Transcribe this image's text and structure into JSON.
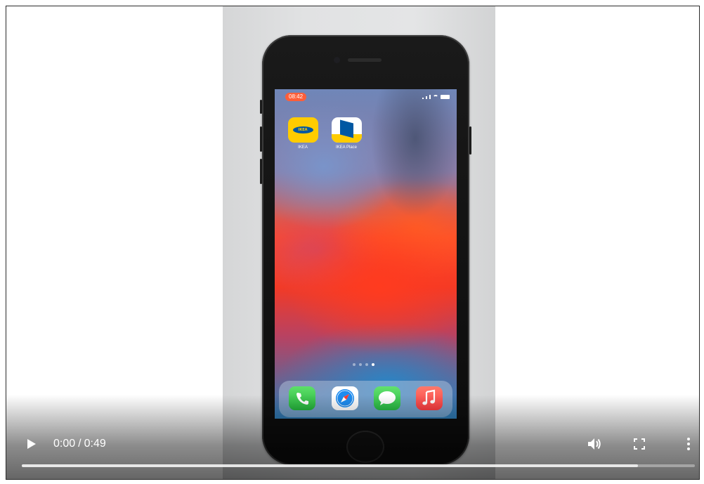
{
  "phone_screen": {
    "status_time": "08:42",
    "apps": [
      {
        "label": "IKEA",
        "icon": "ikea-app-icon"
      },
      {
        "label": "IKEA Place",
        "icon": "ikea-place-app-icon"
      }
    ],
    "ikea_logo_text": "IKEA",
    "page_count": 4,
    "current_page": 4,
    "dock": [
      "phone-icon",
      "safari-icon",
      "messages-icon",
      "music-icon"
    ]
  },
  "player": {
    "current_time": "0:00",
    "separator": "/",
    "duration": "0:49",
    "play_icon": "play-icon",
    "volume_icon": "volume-icon",
    "fullscreen_icon": "fullscreen-icon",
    "more_icon": "more-vert-icon",
    "played_fraction": 0,
    "buffered_fraction": 0.915
  },
  "colors": {
    "ikea_yellow": "#ffcc00",
    "ikea_blue": "#0058a3",
    "status_pill": "#ff5e3a"
  }
}
